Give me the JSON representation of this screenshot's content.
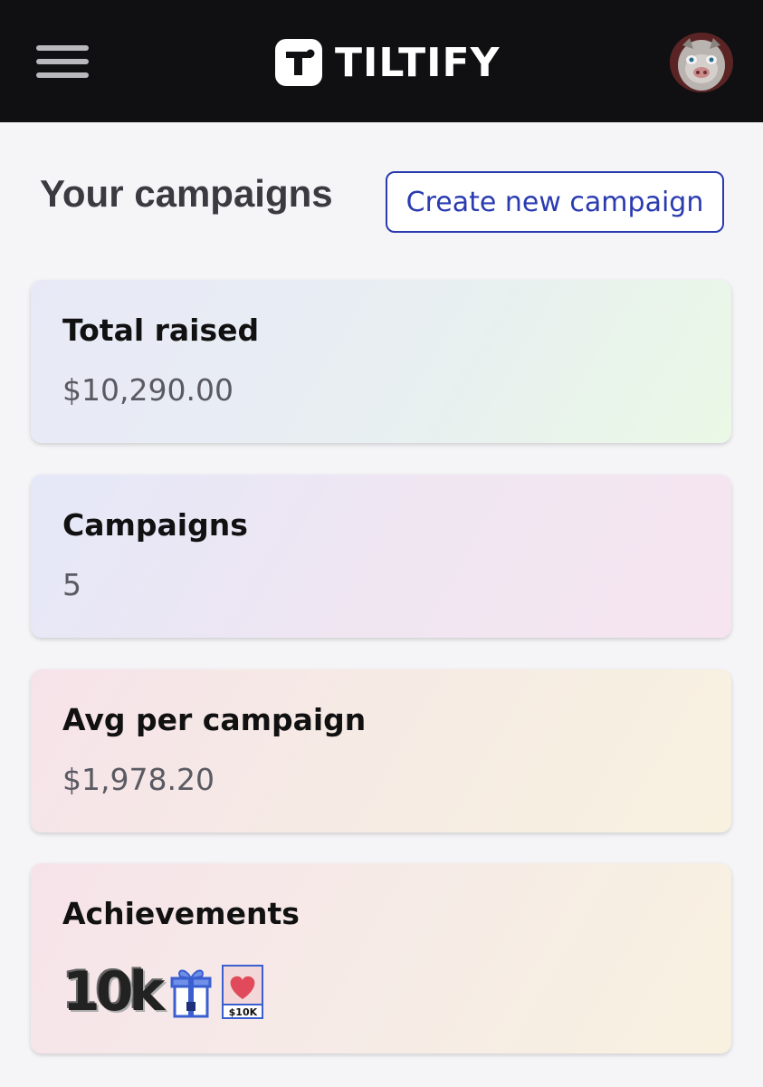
{
  "header": {
    "brand": "TILTIFY"
  },
  "page": {
    "title": "Your campaigns",
    "create_button": "Create new campaign"
  },
  "stats": [
    {
      "label": "Total raised",
      "value": "$10,290.00"
    },
    {
      "label": "Campaigns",
      "value": "5"
    },
    {
      "label": "Avg per campaign",
      "value": "$1,978.20"
    }
  ],
  "achievements": {
    "label": "Achievements",
    "badges": [
      {
        "icon": "10k-badge-icon",
        "text": "10k"
      },
      {
        "icon": "gift-badge-icon"
      },
      {
        "icon": "heart-10k-badge-icon",
        "text": "$10K"
      }
    ]
  }
}
